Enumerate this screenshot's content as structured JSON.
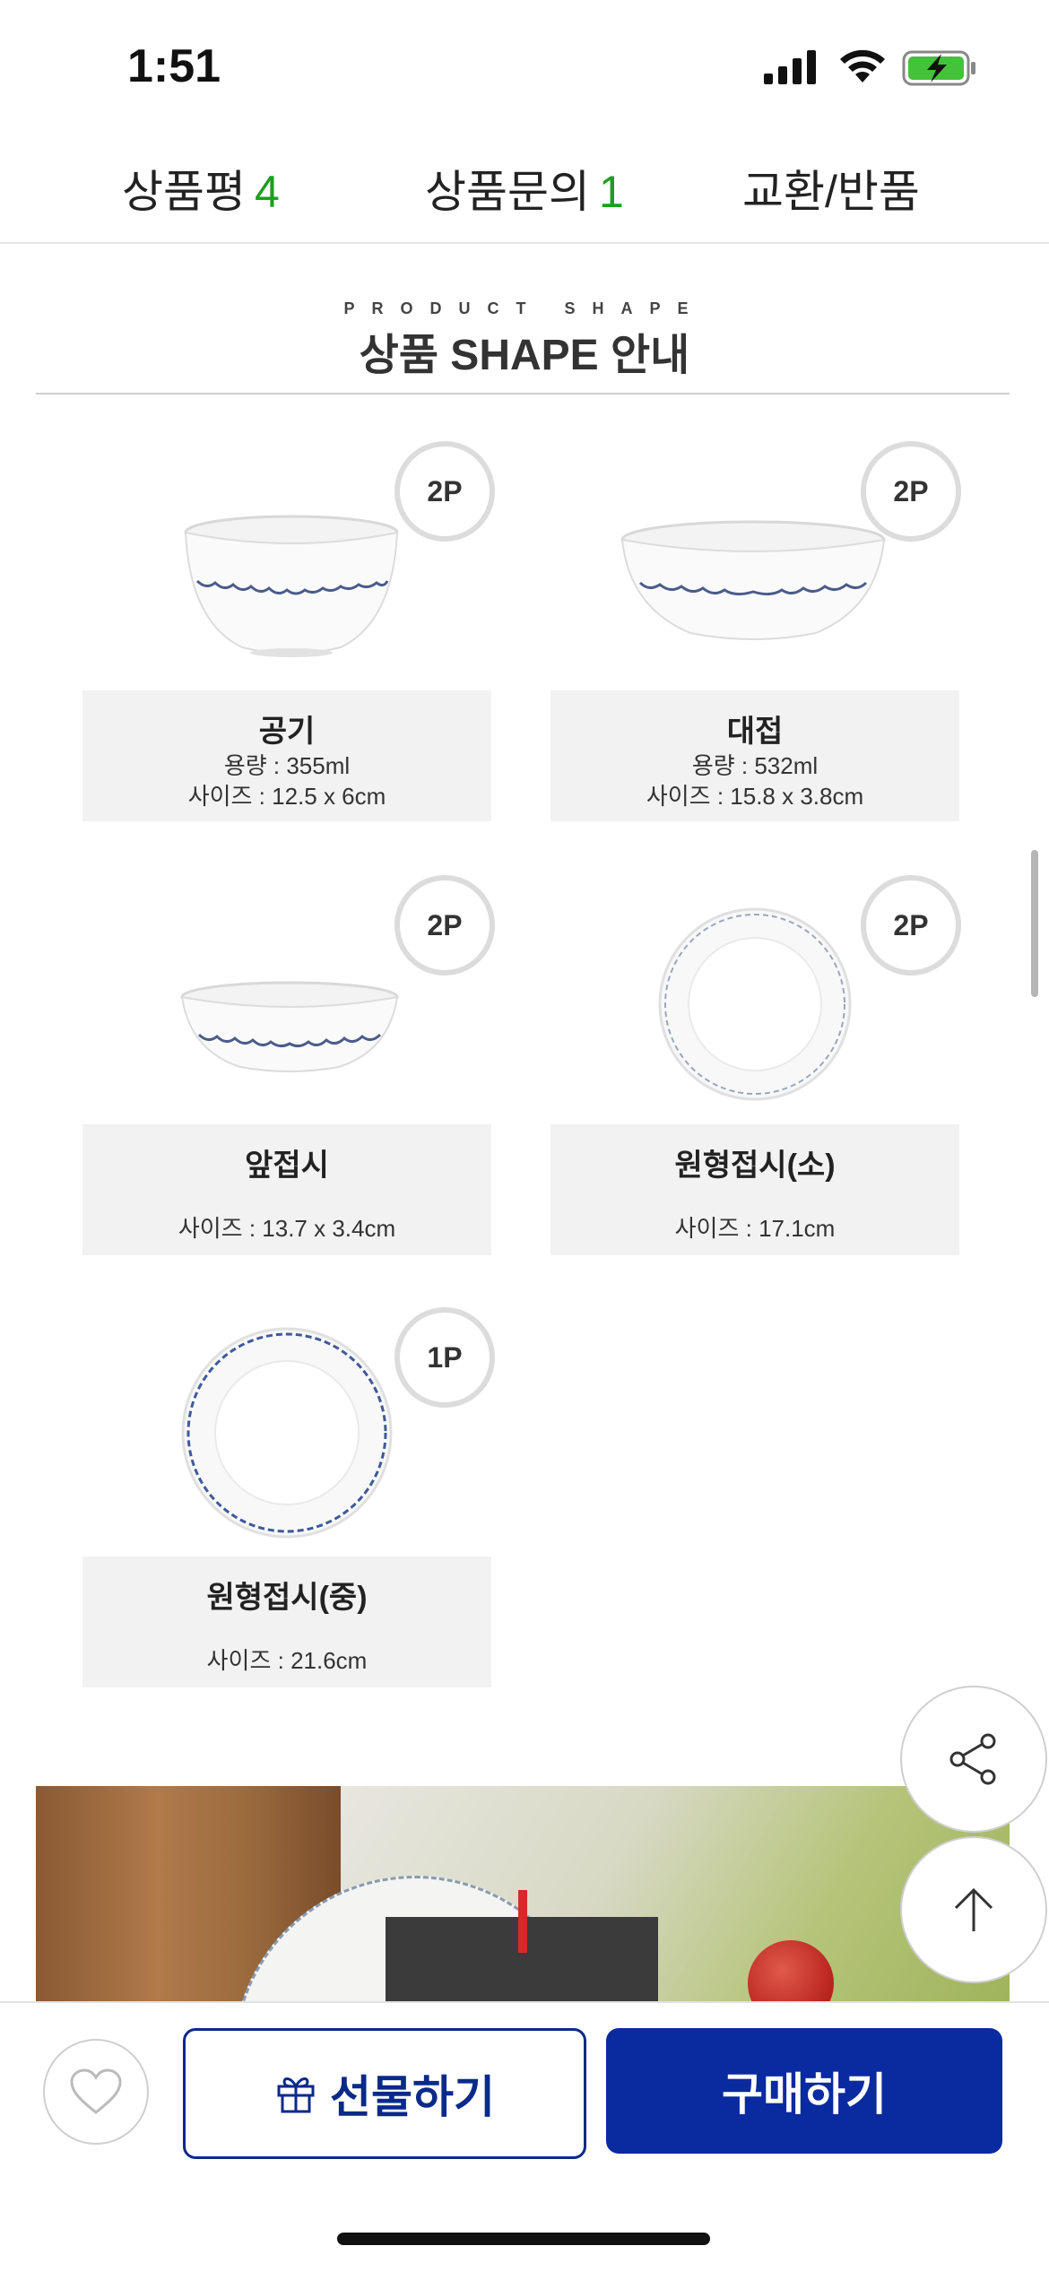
{
  "status_bar": {
    "time": "1:51"
  },
  "tabs": [
    {
      "label": "상품평",
      "count": "4"
    },
    {
      "label": "상품문의",
      "count": "1"
    },
    {
      "label": "교환/반품",
      "count": ""
    }
  ],
  "section": {
    "eyebrow": "PRODUCT SHAPE",
    "title": "상품 SHAPE 안내"
  },
  "products": [
    {
      "name": "공기",
      "qty": "2P",
      "capacity": "용량 : 355ml",
      "size": "사이즈 : 12.5 x 6cm"
    },
    {
      "name": "대접",
      "qty": "2P",
      "capacity": "용량 : 532ml",
      "size": "사이즈 : 15.8 x 3.8cm"
    },
    {
      "name": "앞접시",
      "qty": "2P",
      "capacity": "",
      "size": "사이즈 : 13.7 x 3.4cm"
    },
    {
      "name": "원형접시(소)",
      "qty": "2P",
      "capacity": "",
      "size": "사이즈 : 17.1cm"
    },
    {
      "name": "원형접시(중)",
      "qty": "1P",
      "capacity": "",
      "size": "사이즈 : 21.6cm"
    }
  ],
  "bottom_bar": {
    "gift_label": "선물하기",
    "buy_label": "구매하기"
  },
  "colors": {
    "accent_green": "#1e9e1e",
    "brand_blue": "#0a2aa0"
  }
}
